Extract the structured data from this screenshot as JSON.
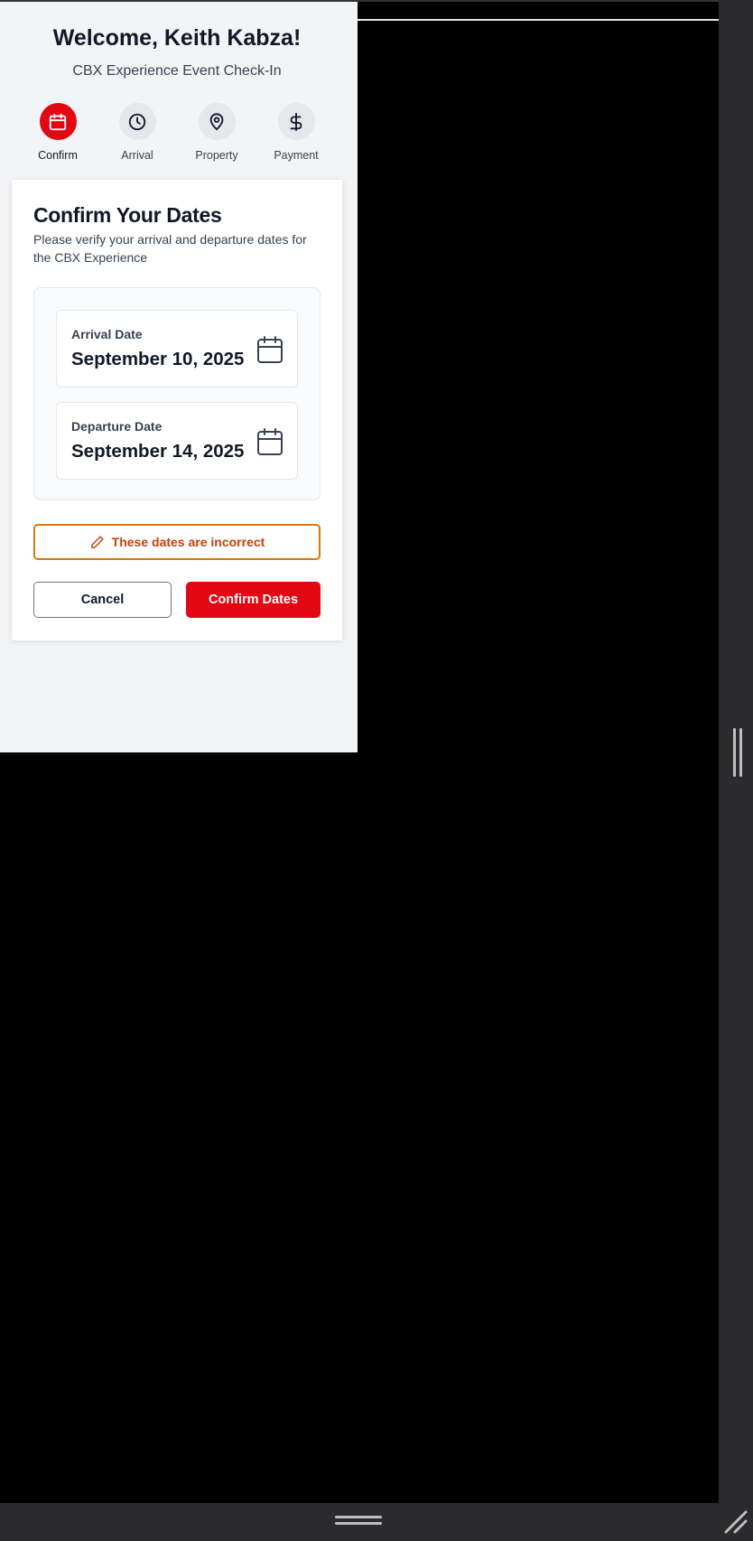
{
  "header": {
    "welcome": "Welcome, Keith Kabza!",
    "subtitle": "CBX Experience Event Check-In"
  },
  "steps": [
    {
      "label": "Confirm",
      "icon": "calendar-icon",
      "active": true
    },
    {
      "label": "Arrival",
      "icon": "clock-icon",
      "active": false
    },
    {
      "label": "Property",
      "icon": "map-pin-icon",
      "active": false
    },
    {
      "label": "Payment",
      "icon": "dollar-icon",
      "active": false
    }
  ],
  "card": {
    "title": "Confirm Your Dates",
    "description": "Please verify your arrival and departure dates for the CBX Experience",
    "arrival": {
      "label": "Arrival Date",
      "value": "September 10, 2025",
      "icon": "calendar-icon"
    },
    "departure": {
      "label": "Departure Date",
      "value": "September 14, 2025",
      "icon": "calendar-icon"
    },
    "incorrect_label": "These dates are incorrect",
    "incorrect_icon": "pencil-icon",
    "cancel_label": "Cancel",
    "confirm_label": "Confirm Dates"
  },
  "colors": {
    "accent": "#e30613",
    "warning": "#c2410c",
    "panel_bg": "#f3f4f6",
    "page_bg": "#000000"
  }
}
